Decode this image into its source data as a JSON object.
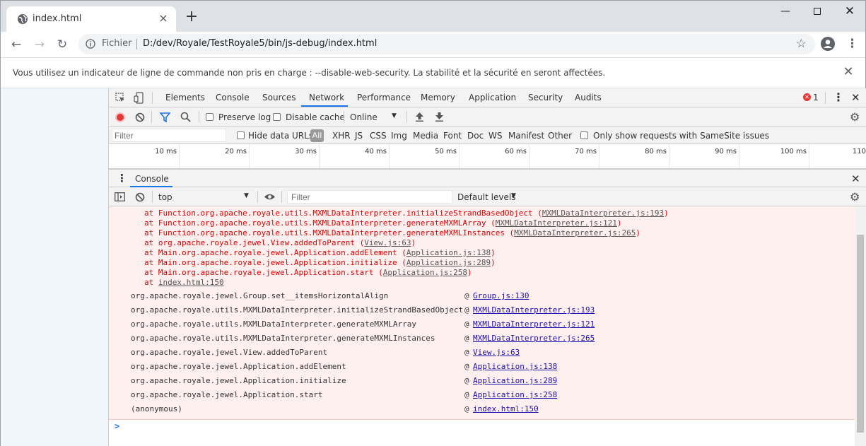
{
  "tab": {
    "title": "index.html"
  },
  "address": {
    "scheme_label": "Fichier",
    "url": "D:/dev/Royale/TestRoyale5/bin/js-debug/index.html"
  },
  "infobar": {
    "message": "Vous utilisez un indicateur de ligne de commande non pris en charge : --disable-web-security. La stabilité et la sécurité en seront affectées."
  },
  "devtools": {
    "tabs": [
      "Elements",
      "Console",
      "Sources",
      "Network",
      "Performance",
      "Memory",
      "Application",
      "Security",
      "Audits"
    ],
    "active_tab": "Network",
    "error_count": "1",
    "network_toolbar": {
      "preserve_log": "Preserve log",
      "disable_cache": "Disable cache",
      "throttling": "Online"
    },
    "filter_bar": {
      "placeholder": "Filter",
      "hide_data_urls": "Hide data URLs",
      "all": "All",
      "types": [
        "XHR",
        "JS",
        "CSS",
        "Img",
        "Media",
        "Font",
        "Doc",
        "WS",
        "Manifest",
        "Other"
      ],
      "samesite": "Only show requests with SameSite issues"
    },
    "timeline_ticks": [
      "10 ms",
      "20 ms",
      "30 ms",
      "40 ms",
      "50 ms",
      "60 ms",
      "70 ms",
      "80 ms",
      "90 ms",
      "100 ms",
      "110"
    ],
    "drawer": {
      "tab": "Console",
      "context": "top",
      "filter_placeholder": "Filter",
      "levels": "Default levels"
    },
    "console": {
      "stack_lines": [
        {
          "text": "at Function.org.apache.royale.utils.MXMLDataInterpreter.initializeStrandBasedObject (",
          "link": "MXMLDataInterpreter.js:193",
          "end": ")"
        },
        {
          "text": "at Function.org.apache.royale.utils.MXMLDataInterpreter.generateMXMLArray (",
          "link": "MXMLDataInterpreter.js:121",
          "end": ")"
        },
        {
          "text": "at Function.org.apache.royale.utils.MXMLDataInterpreter.generateMXMLInstances (",
          "link": "MXMLDataInterpreter.js:265",
          "end": ")"
        },
        {
          "text": "at org.apache.royale.jewel.View.addedToParent (",
          "link": "View.js:63",
          "end": ")"
        },
        {
          "text": "at Main.org.apache.royale.jewel.Application.addElement (",
          "link": "Application.js:138",
          "end": ")"
        },
        {
          "text": "at Main.org.apache.royale.jewel.Application.initialize (",
          "link": "Application.js:289",
          "end": ")"
        },
        {
          "text": "at Main.org.apache.royale.jewel.Application.start (",
          "link": "Application.js:258",
          "end": ")"
        },
        {
          "text": "at ",
          "link": "index.html:150",
          "end": ""
        }
      ],
      "stack_rows": [
        {
          "fn": "org.apache.royale.jewel.Group.set__itemsHorizontalAlign",
          "at": "@",
          "loc": "Group.js:130"
        },
        {
          "fn": "org.apache.royale.utils.MXMLDataInterpreter.initializeStrandBasedObject",
          "at": "@",
          "loc": "MXMLDataInterpreter.js:193"
        },
        {
          "fn": "org.apache.royale.utils.MXMLDataInterpreter.generateMXMLArray",
          "at": "@",
          "loc": "MXMLDataInterpreter.js:121"
        },
        {
          "fn": "org.apache.royale.utils.MXMLDataInterpreter.generateMXMLInstances",
          "at": "@",
          "loc": "MXMLDataInterpreter.js:265"
        },
        {
          "fn": "org.apache.royale.jewel.View.addedToParent",
          "at": "@",
          "loc": "View.js:63"
        },
        {
          "fn": "org.apache.royale.jewel.Application.addElement",
          "at": "@",
          "loc": "Application.js:138"
        },
        {
          "fn": "org.apache.royale.jewel.Application.initialize",
          "at": "@",
          "loc": "Application.js:289"
        },
        {
          "fn": "org.apache.royale.jewel.Application.start",
          "at": "@",
          "loc": "Application.js:258"
        },
        {
          "fn": "(anonymous)",
          "at": "@",
          "loc": "index.html:150"
        }
      ],
      "prompt": ">"
    }
  },
  "colors": {
    "error_bg": "#fff0f0",
    "error_text": "#dd0000",
    "link_blue": "#1a0dab",
    "active_tab_underline": "#1a73e8",
    "record_red": "#e53935"
  }
}
